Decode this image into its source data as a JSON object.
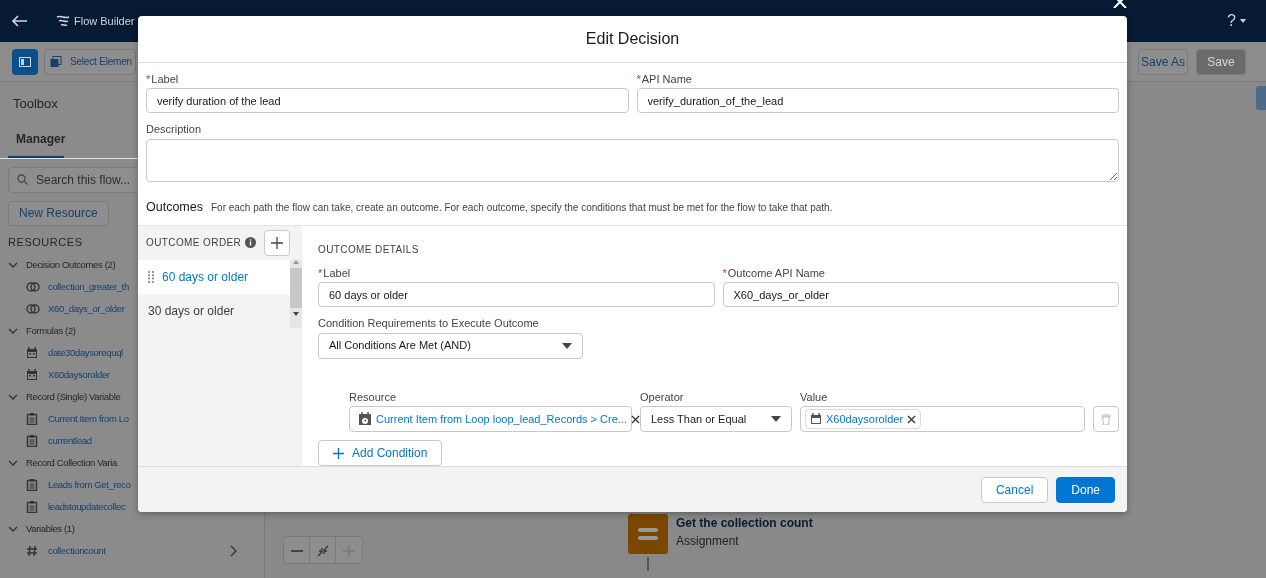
{
  "header": {
    "title": "Flow Builder",
    "help": "?"
  },
  "toolbar": {
    "select_button": "Select Elemen",
    "buttons": [
      {
        "label": "Save As",
        "disabled": false
      },
      {
        "label": "Save",
        "disabled": true
      }
    ]
  },
  "sidebar": {
    "title": "Toolbox",
    "tabs": [
      {
        "label": "Manager",
        "selected": true
      }
    ],
    "search": {
      "placeholder": "Search this flow..."
    },
    "new_button": "New Resource",
    "section": "RESOURCES",
    "tree": [
      {
        "label": "Decision Outcomes (2)",
        "expanded": true,
        "children": [
          {
            "label": "collection_greater_th",
            "kind": "outcome"
          },
          {
            "label": "X60_days_or_older",
            "kind": "outcome"
          }
        ]
      },
      {
        "label": "Formulas (2)",
        "expanded": true,
        "children": [
          {
            "label": "date30daysorequql",
            "kind": "formula"
          },
          {
            "label": "X60daysorolder",
            "kind": "formula"
          }
        ]
      },
      {
        "label": "Record (Single) Variable",
        "expanded": true,
        "children": [
          {
            "label": "Current Item from Lo",
            "kind": "record"
          },
          {
            "label": "currentlead",
            "kind": "record"
          }
        ]
      },
      {
        "label": "Record Collection Varia",
        "expanded": true,
        "children": [
          {
            "label": "Leads from Get_reco",
            "kind": "record"
          },
          {
            "label": "leadstoupdatecollec",
            "kind": "record"
          }
        ]
      },
      {
        "label": "Variables (1)",
        "expanded": true,
        "children": [
          {
            "label": "collectioncount",
            "kind": "number"
          }
        ]
      }
    ]
  },
  "canvas": {
    "node": {
      "title": "Get the collection count",
      "subtitle": "Assignment"
    }
  },
  "dialog": {
    "title": "Edit Decision",
    "label": {
      "mark": "*",
      "label": "Label",
      "value": "verify duration of the lead"
    },
    "api_name": {
      "mark": "*",
      "label": "API Name",
      "value": "verify_duration_of_the_lead"
    },
    "description": {
      "label": "Description"
    },
    "outcomes_heading": "Outcomes",
    "outcomes_help": "For each path the flow can take, create an outcome. For each outcome, specify the conditions that must be met for the flow to take that path.",
    "outcome_order": {
      "heading": "OUTCOME ORDER",
      "items": [
        {
          "label": "60 days or older",
          "selected": true
        },
        {
          "label": "30 days or older",
          "selected": false
        }
      ]
    },
    "details": {
      "heading": "OUTCOME DETAILS",
      "label": {
        "mark": "*",
        "label": "Label",
        "value": "60 days or older"
      },
      "api_name": {
        "mark": "*",
        "label": "Outcome API Name",
        "value": "X60_days_or_older"
      },
      "requirements": {
        "label": "Condition Requirements to Execute Outcome",
        "value": "All Conditions Are Met (AND)"
      },
      "condition": {
        "resource_label": "Resource",
        "resource": "Current Item from Loop loop_lead_Records > Cre...",
        "operator_label": "Operator",
        "operator": "Less Than or Equal",
        "value_label": "Value",
        "value": "X60daysorolder"
      },
      "add_condition": "Add Condition"
    },
    "buttons": [
      {
        "label": "Cancel",
        "kind": "neutral"
      },
      {
        "label": "Done",
        "kind": "brand"
      }
    ]
  }
}
